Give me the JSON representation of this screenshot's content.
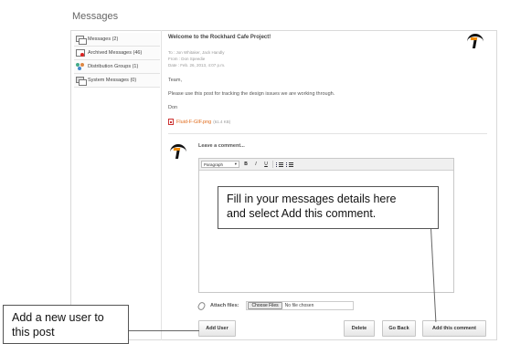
{
  "page": {
    "title": "Messages"
  },
  "sidebar": {
    "items": [
      {
        "icon": "messages-icon",
        "label": "Messages (2)"
      },
      {
        "icon": "archive-icon",
        "label": "Archived Messages (46)"
      },
      {
        "icon": "group-icon",
        "label": "Distribution Groups (1)"
      },
      {
        "icon": "system-messages-icon",
        "label": "System Messages (0)"
      }
    ]
  },
  "message": {
    "title": "Welcome to the Rockhard Cafe Project!",
    "to": "To : Jon Whitaker, Jack Handly",
    "from": "From : Don Speedie",
    "date": "Date : Feb. 26, 2013, 4:07 p.m.",
    "greeting": "Team,",
    "body": "Please use this post for tracking the design issues we are working through.",
    "signature": "Don",
    "attachment": {
      "name": "Fluid-F-GIF.png",
      "size": "(61.4 KB)"
    }
  },
  "comment": {
    "heading": "Leave a comment...",
    "format_select": "Paragraph",
    "toolbar": {
      "bold": "B",
      "italic": "I",
      "underline": "U"
    }
  },
  "attach": {
    "label": "Attach files:",
    "choose_button": "Choose Files",
    "no_file": "No file chosen"
  },
  "buttons": {
    "add_user": "Add User",
    "delete": "Delete",
    "go_back": "Go Back",
    "add_comment": "Add this comment"
  },
  "callouts": {
    "details_line1": "Fill in your messages details here",
    "details_line2": "and select Add this comment.",
    "user_line1": "Add a new user to",
    "user_line2": "this post"
  },
  "colors": {
    "link": "#e06a1a",
    "logo_accent": "#f08a00",
    "logo": "#111111"
  }
}
